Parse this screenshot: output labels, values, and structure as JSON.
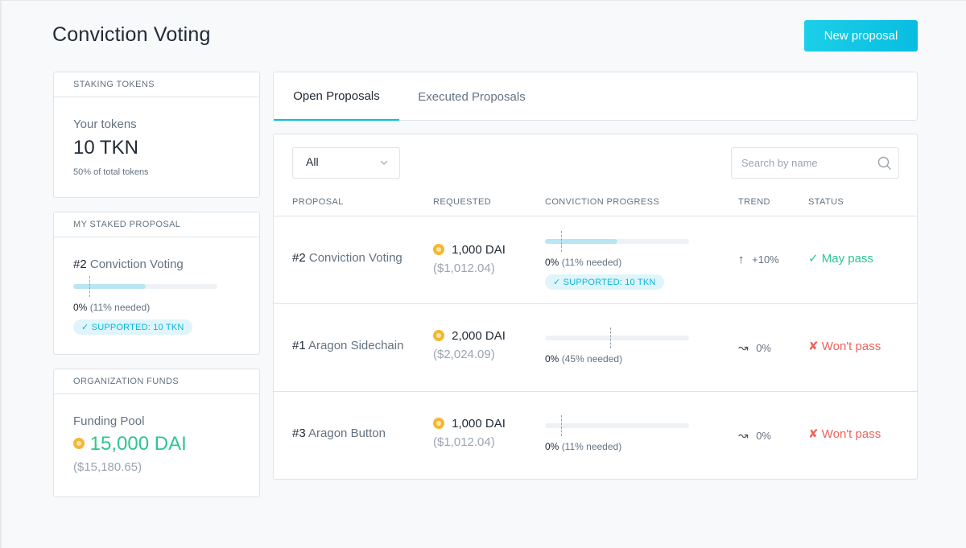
{
  "header": {
    "title": "Conviction Voting",
    "new_proposal_label": "New proposal"
  },
  "staking": {
    "heading": "STAKING TOKENS",
    "label": "Your tokens",
    "amount": "10 TKN",
    "share": "50% of total tokens"
  },
  "my_staked": {
    "heading": "MY STAKED PROPOSAL",
    "number": "#2",
    "name": "Conviction Voting",
    "progress_pct": "0%",
    "needed": "(11% needed)",
    "progress": 0.5,
    "threshold": 0.11,
    "badge": "✓ SUPPORTED: 10 TKN"
  },
  "funds": {
    "heading": "ORGANIZATION FUNDS",
    "label": "Funding Pool",
    "amount": "15,000 DAI",
    "usd": "($15,180.65)"
  },
  "tabs": [
    {
      "label": "Open Proposals",
      "active": true
    },
    {
      "label": "Executed Proposals",
      "active": false
    }
  ],
  "filter": {
    "value": "All"
  },
  "search": {
    "placeholder": "Search by name"
  },
  "columns": [
    "PROPOSAL",
    "REQUESTED",
    "CONVICTION PROGRESS",
    "TREND",
    "STATUS"
  ],
  "proposals": [
    {
      "number": "#2",
      "name": "Conviction Voting",
      "amount": "1,000 DAI",
      "usd": "($1,012.04)",
      "progress_pct": "0%",
      "needed": "(11% needed)",
      "progress": 0.5,
      "threshold": 0.11,
      "badge": "✓ SUPPORTED: 10 TKN",
      "trend_icon": "↑",
      "trend": "+10%",
      "status": "✓ May pass",
      "status_kind": "pass"
    },
    {
      "number": "#1",
      "name": "Aragon Sidechain",
      "amount": "2,000 DAI",
      "usd": "($2,024.09)",
      "progress_pct": "0%",
      "needed": "(45% needed)",
      "progress": 0,
      "threshold": 0.45,
      "badge": "",
      "trend_icon": "↝",
      "trend": "0%",
      "status": "✘ Won't pass",
      "status_kind": "fail"
    },
    {
      "number": "#3",
      "name": "Aragon Button",
      "amount": "1,000 DAI",
      "usd": "($1,012.04)",
      "progress_pct": "0%",
      "needed": "(11% needed)",
      "progress": 0,
      "threshold": 0.11,
      "badge": "",
      "trend_icon": "↝",
      "trend": "0%",
      "status": "✘ Won't pass",
      "status_kind": "fail"
    }
  ],
  "colors": {
    "accent": "#08bde0",
    "pass": "#2cc68f",
    "fail": "#f0625c",
    "coin": "#f4b733"
  }
}
